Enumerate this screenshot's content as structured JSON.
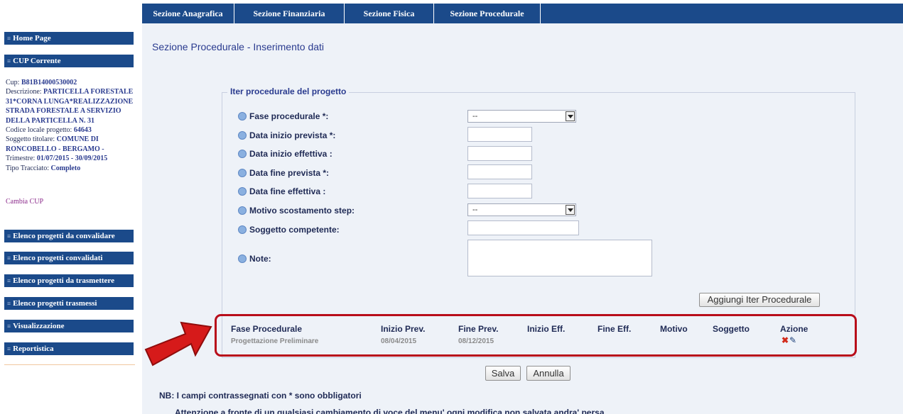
{
  "topnav": {
    "tabs": [
      "Sezione Anagrafica",
      "Sezione Finanziaria",
      "Sezione Fisica",
      "Sezione Procedurale"
    ]
  },
  "sidebar": {
    "home_page": "Home Page",
    "cup_corrente": "CUP Corrente",
    "cup_info": {
      "cup_label": "Cup: ",
      "cup_value": "B81B14000530002",
      "descrizione_label": "Descrizione: ",
      "descrizione_value": "PARTICELLA FORESTALE 31*CORNA LUNGA*REALIZZAZIONE STRADA FORESTALE A SERVIZIO DELLA PARTICELLA N. 31",
      "codice_label": "Codice locale progetto: ",
      "codice_value": "64643",
      "soggetto_label": "Soggetto titolare: ",
      "soggetto_value": "COMUNE DI RONCOBELLO - BERGAMO -",
      "trimestre_label": "Trimestre: ",
      "trimestre_value": "01/07/2015 - 30/09/2015",
      "tracciato_label": "Tipo Tracciato: ",
      "tracciato_value": "Completo"
    },
    "cambia_cup": "Cambia CUP",
    "menu": [
      "Elenco progetti da convalidare",
      "Elenco progetti convalidati",
      "Elenco progetti da trasmettere",
      "Elenco progetti trasmessi",
      "Visualizzazione",
      "Reportistica"
    ]
  },
  "main": {
    "title": "Sezione Procedurale - Inserimento dati",
    "legend": "Iter procedurale del progetto",
    "fields": {
      "fase_label": "Fase procedurale *:",
      "fase_value": "--",
      "data_inizio_prevista_label": "Data inizio prevista *:",
      "data_inizio_effettiva_label": "Data inizio effettiva :",
      "data_fine_prevista_label": "Data fine prevista *:",
      "data_fine_effettiva_label": "Data fine effettiva :",
      "motivo_label": "Motivo scostamento step:",
      "motivo_value": "--",
      "soggetto_label": "Soggetto competente:",
      "note_label": "Note:"
    },
    "add_button": "Aggiungi Iter Procedurale",
    "table": {
      "headers": [
        "Fase Procedurale",
        "Inizio Prev.",
        "Fine Prev.",
        "Inizio Eff.",
        "Fine Eff.",
        "Motivo",
        "Soggetto",
        "Azione"
      ],
      "row": [
        "Progettazione Preliminare",
        "08/04/2015",
        "08/12/2015"
      ],
      "delete_icon_glyph": "✖",
      "edit_icon_glyph": "✎"
    },
    "save_button": "Salva",
    "cancel_button": "Annulla",
    "note_required": "NB: I campi contrassegnati con * sono obbligatori",
    "note_warning": "Attenzione a fronte di un qualsiasi cambiamento di voce del menu' ogni modifica non salvata andra' persa"
  },
  "colors": {
    "nav_blue": "#1b4a8a",
    "highlight_red": "#b80d1a",
    "arrow_red": "#d61a1a",
    "main_bg": "#eef2f8"
  }
}
